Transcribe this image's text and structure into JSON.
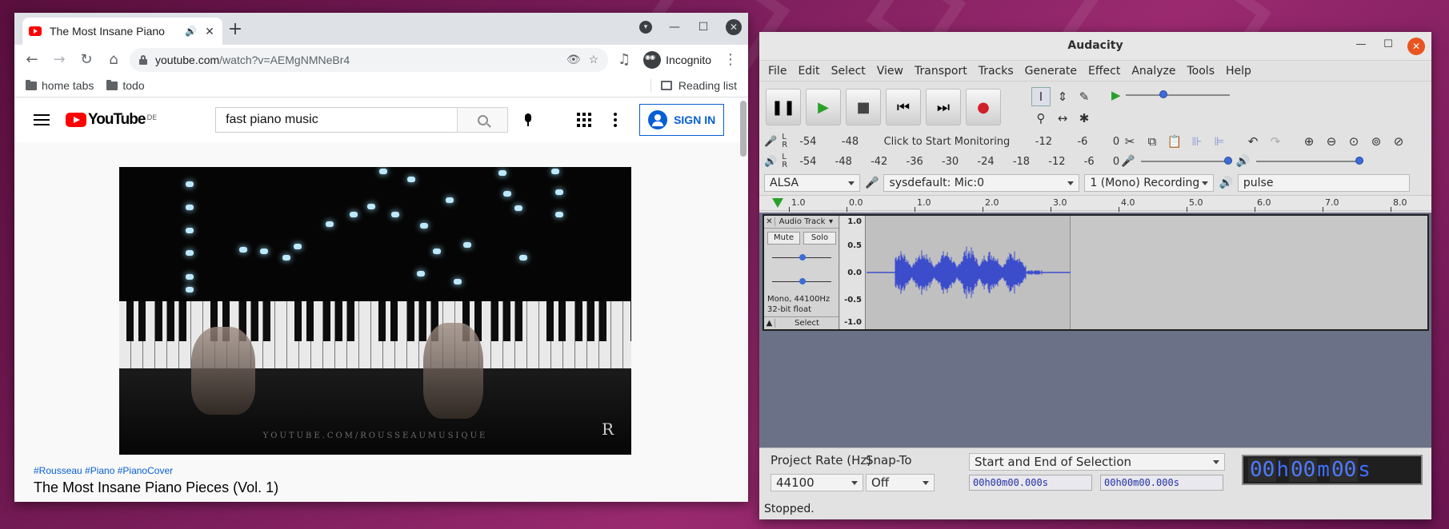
{
  "chrome": {
    "tab_title": "The Most Insane Piano Pieces (Vol. 1)",
    "tab_title_visible": "The Most Insane Piano",
    "url_host": "youtube.com",
    "url_path": "/watch?v=AEMgNMNeBr4",
    "profile_label": "Incognito",
    "bookmarks": [
      {
        "label": "home tabs"
      },
      {
        "label": "todo"
      }
    ],
    "reading_list_label": "Reading list"
  },
  "youtube": {
    "logo_text": "YouTube",
    "region": "DE",
    "search_value": "fast piano music",
    "sign_in_label": "SIGN IN",
    "video_watermark": "YOUTUBE.COM/ROUSSEAUMUSIQUE",
    "video_mark": "R",
    "hashtags": "#Rousseau #Piano #PianoCover",
    "video_title": "The Most Insane Piano Pieces (Vol. 1)"
  },
  "audacity": {
    "title": "Audacity",
    "menu": [
      "File",
      "Edit",
      "Select",
      "View",
      "Transport",
      "Tracks",
      "Generate",
      "Effect",
      "Analyze",
      "Tools",
      "Help"
    ],
    "meter_ticks_record": [
      "-54",
      "-48",
      "Click to Start Monitoring",
      "-12",
      "-6",
      "0"
    ],
    "meter_ticks_play": [
      "-54",
      "-48",
      "-42",
      "-36",
      "-30",
      "-24",
      "-18",
      "-12",
      "-6",
      "0"
    ],
    "host": "ALSA",
    "recording_device": "sysdefault: Mic:0",
    "channels": "1 (Mono) Recording",
    "playback_device": "pulse",
    "timeline_ticks": [
      "1.0",
      "0.0",
      "1.0",
      "2.0",
      "3.0",
      "4.0",
      "5.0",
      "6.0",
      "7.0",
      "8.0"
    ],
    "track": {
      "name": "Audio Track",
      "mute": "Mute",
      "solo": "Solo",
      "info_line1": "Mono, 44100Hz",
      "info_line2": "32-bit float",
      "select": "Select",
      "scale": [
        "1.0",
        "0.5",
        "0.0",
        "-0.5",
        "-1.0"
      ],
      "audio_length_seconds": 3.0
    },
    "project_rate_label": "Project Rate (Hz)",
    "project_rate_value": "44100",
    "snap_to_label": "Snap-To",
    "snap_to_value": "Off",
    "selection_mode": "Start and End of Selection",
    "sel_start": "00h00m00.000s",
    "sel_end": "00h00m00.000s",
    "time_display": [
      "00",
      "h",
      "00",
      "m",
      "00",
      "s"
    ],
    "status": "Stopped.",
    "colors": {
      "waveform": "#3c4dcc",
      "record": "#d0202a",
      "play": "#2aa12a"
    }
  }
}
